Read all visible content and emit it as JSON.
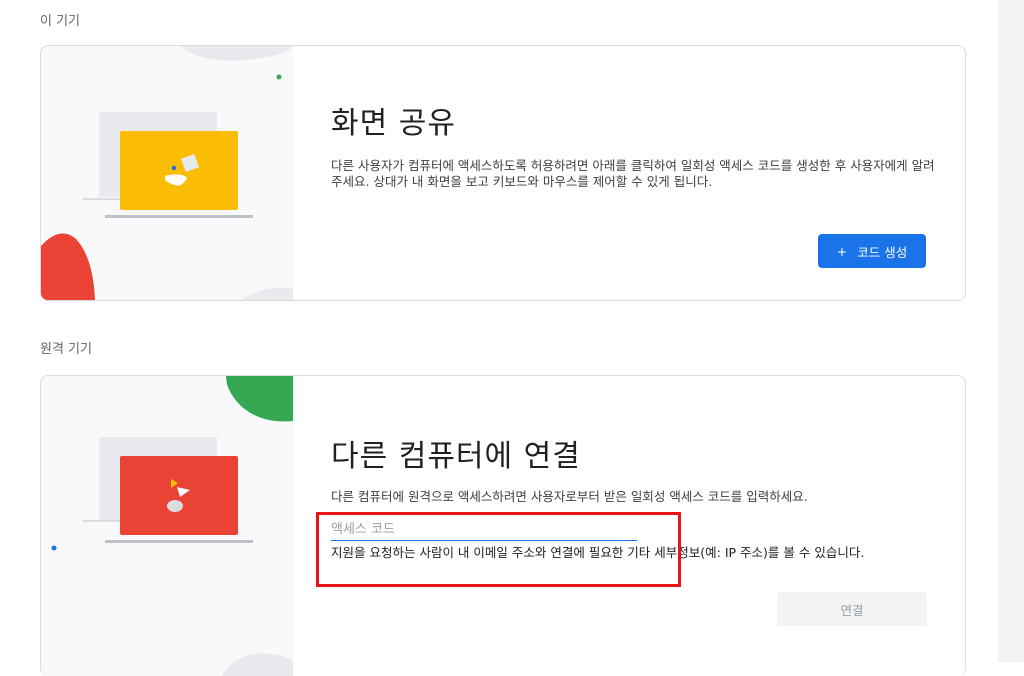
{
  "section_this_device": {
    "title": "이 기기"
  },
  "share_card": {
    "heading": "화면 공유",
    "description": "다른 사용자가 컴퓨터에 액세스하도록 허용하려면 아래를 클릭하여 일회성 액세스 코드를 생성한 후 사용자에게 알려 주세요. 상대가 내 화면을 보고 키보드와 마우스를 제어할 수 있게 됩니다.",
    "button_icon": "+",
    "button_label": "코드 생성"
  },
  "section_remote_device": {
    "title": "원격 기기"
  },
  "connect_card": {
    "heading": "다른 컴퓨터에 연결",
    "description": "다른 컴퓨터에 원격으로 액세스하려면 사용자로부터 받은 일회성 액세스 코드를 입력하세요.",
    "input_placeholder": "액세스 코드",
    "input_value": "",
    "hint": "지원을 요청하는 사람이 내 이메일 주소와 연결에 필요한 기타 세부정보(예: IP 주소)를 볼 수 있습니다.",
    "button_label": "연결"
  },
  "colors": {
    "accent_blue": "#1a73e8",
    "yellow": "#fbbc04",
    "red": "#ea4335",
    "green": "#34a853",
    "highlight": "#e8141a"
  },
  "icons": {
    "share_illustration": "laptop-yellow-illustration",
    "connect_illustration": "laptop-red-illustration"
  }
}
